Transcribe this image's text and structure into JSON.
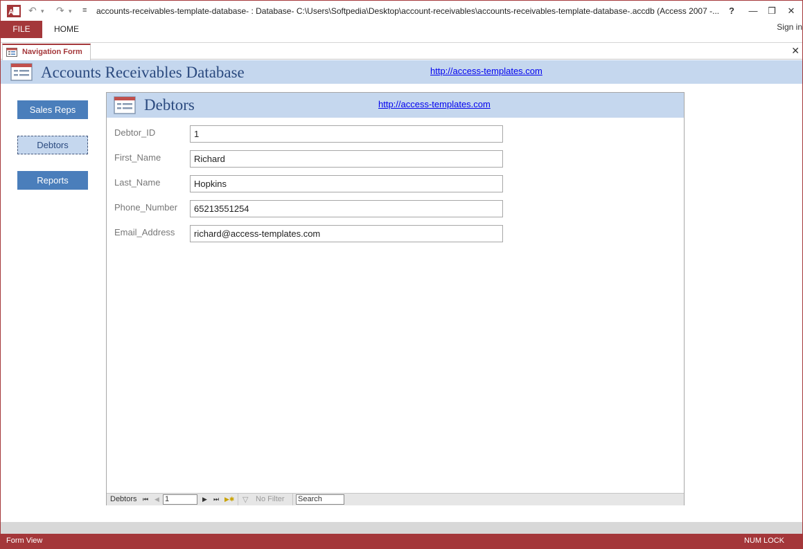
{
  "titlebar": {
    "title": "accounts-receivables-template-database- : Database- C:\\Users\\Softpedia\\Desktop\\account-receivables\\accounts-receivables-template-database-.accdb (Access 2007 -...",
    "undo_icon": "undo-icon",
    "redo_icon": "redo-icon",
    "help_label": "?",
    "restore_label": "❒",
    "minimize_label": "—",
    "close_label": "✕"
  },
  "ribbon": {
    "file_label": "FILE",
    "home_label": "HOME",
    "signin_label": "Sign in",
    "accent_color": "#a4373a"
  },
  "doctab": {
    "label": "Navigation Form",
    "close_label": "✕"
  },
  "nav_form": {
    "title": "Accounts Receivables Database",
    "link": "http://access-templates.com",
    "buttons": [
      {
        "label": "Sales Reps",
        "active": false
      },
      {
        "label": "Debtors",
        "active": true
      },
      {
        "label": "Reports",
        "active": false
      }
    ]
  },
  "subform": {
    "title": "Debtors",
    "link": "http://access-templates.com",
    "fields": [
      {
        "label": "Debtor_ID",
        "value": "1"
      },
      {
        "label": "First_Name",
        "value": "Richard"
      },
      {
        "label": "Last_Name",
        "value": "Hopkins"
      },
      {
        "label": "Phone_Number",
        "value": "65213551254"
      },
      {
        "label": "Email_Address",
        "value": "richard@access-templates.com"
      }
    ]
  },
  "record_nav": {
    "label": "Debtors",
    "current_record": "1",
    "filter_label": "No Filter",
    "search_placeholder": "Search"
  },
  "statusbar": {
    "view_label": "Form View",
    "numlock_label": "NUM LOCK"
  }
}
